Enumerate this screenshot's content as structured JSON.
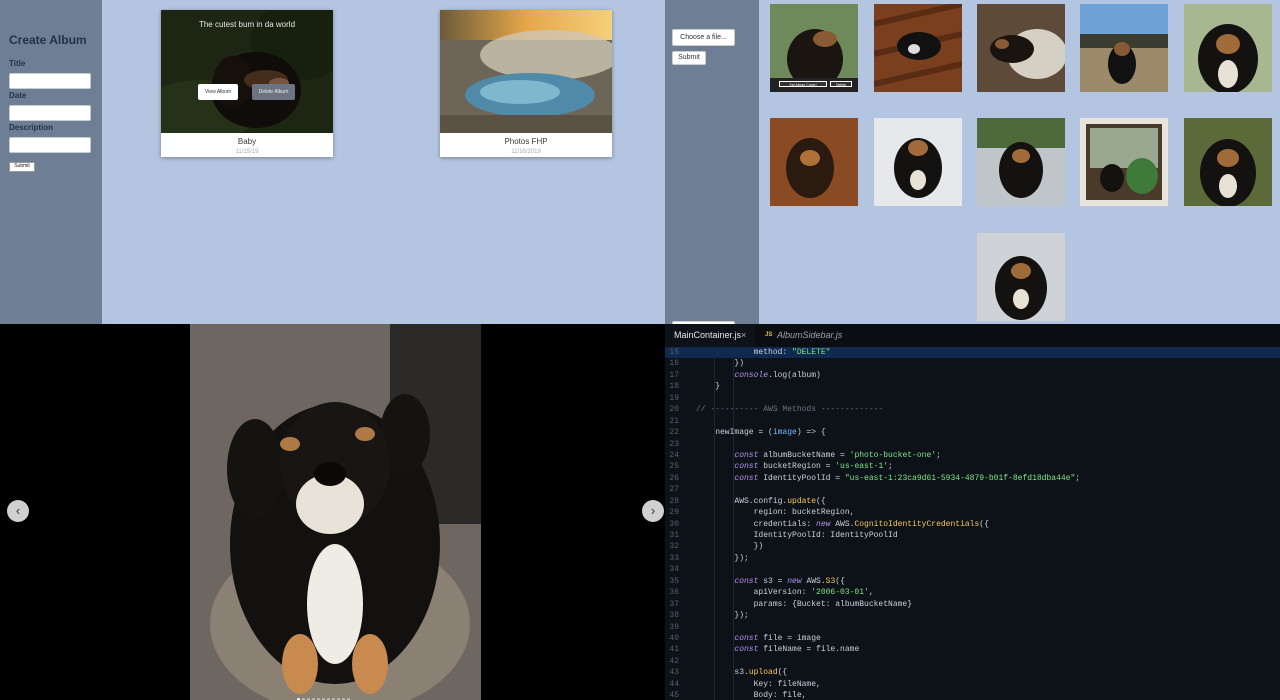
{
  "albums_view": {
    "sidebar": {
      "heading": "Create Album",
      "title_label": "Title",
      "date_label": "Date",
      "description_label": "Description",
      "submit_label": "Submit"
    },
    "albums": [
      {
        "name": "Baby",
        "date": "11/15/19",
        "overlay_text": "The cutest bum in da world",
        "view_label": "View Album",
        "delete_label": "Delete Album"
      },
      {
        "name": "Photos FHP",
        "date": "11/16/2019"
      }
    ]
  },
  "photos_view": {
    "choose_file_label": "Choose a file...",
    "submit_label": "Submit",
    "set_cover_label": "Set Album Cover!",
    "delete_label": "Delete"
  },
  "viewer": {
    "prev_icon": "‹",
    "next_icon": "›"
  },
  "editor": {
    "tabs": [
      {
        "label": "MainContainer.js",
        "active": true,
        "close": "×"
      },
      {
        "label": "AlbumSidebar.js",
        "active": false,
        "badge": "JS"
      }
    ],
    "lines": [
      {
        "n": "15",
        "text": "            method: \"DELETE\""
      },
      {
        "n": "16",
        "text": "        })"
      },
      {
        "n": "17",
        "text": "        console.log(album)"
      },
      {
        "n": "18",
        "text": "    }"
      },
      {
        "n": "19",
        "text": ""
      },
      {
        "n": "20",
        "text": "// ---------- AWS Methods -------------"
      },
      {
        "n": "21",
        "text": ""
      },
      {
        "n": "22",
        "text": "    newImage = (image) => {"
      },
      {
        "n": "23",
        "text": ""
      },
      {
        "n": "24",
        "text": "        const albumBucketName = 'photo-bucket-one';"
      },
      {
        "n": "25",
        "text": "        const bucketRegion = 'us-east-1';"
      },
      {
        "n": "26",
        "text": "        const IdentityPoolId = \"us-east-1:23ca9d61-5934-4879-b01f-8efd18dba44e\";"
      },
      {
        "n": "27",
        "text": ""
      },
      {
        "n": "28",
        "text": "        AWS.config.update({"
      },
      {
        "n": "29",
        "text": "            region: bucketRegion,"
      },
      {
        "n": "30",
        "text": "            credentials: new AWS.CognitoIdentityCredentials({"
      },
      {
        "n": "31",
        "text": "            IdentityPoolId: IdentityPoolId"
      },
      {
        "n": "32",
        "text": "            })"
      },
      {
        "n": "33",
        "text": "        });"
      },
      {
        "n": "34",
        "text": ""
      },
      {
        "n": "35",
        "text": "        const s3 = new AWS.S3({"
      },
      {
        "n": "36",
        "text": "            apiVersion: '2006-03-01',"
      },
      {
        "n": "37",
        "text": "            params: {Bucket: albumBucketName}"
      },
      {
        "n": "38",
        "text": "        });"
      },
      {
        "n": "39",
        "text": ""
      },
      {
        "n": "40",
        "text": "        const file = image"
      },
      {
        "n": "41",
        "text": "        const fileName = file.name"
      },
      {
        "n": "42",
        "text": ""
      },
      {
        "n": "43",
        "text": "        s3.upload({"
      },
      {
        "n": "44",
        "text": "            Key: fileName,"
      },
      {
        "n": "45",
        "text": "            Body: file,"
      }
    ]
  }
}
